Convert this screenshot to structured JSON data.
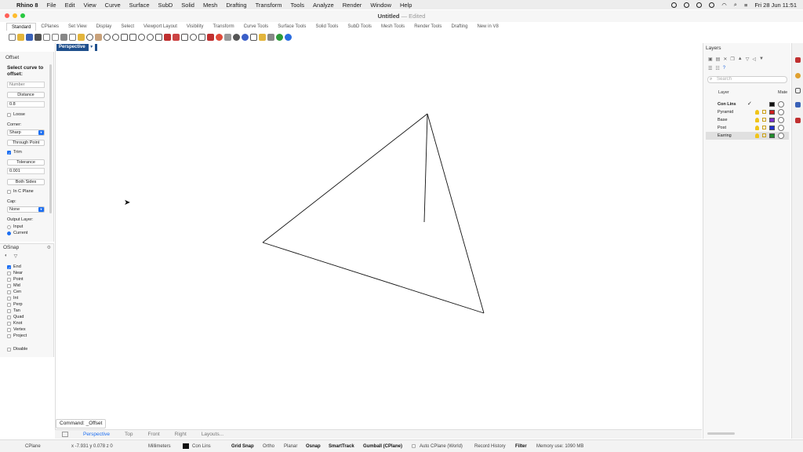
{
  "menubar": {
    "app": "Rhino 8",
    "items": [
      "File",
      "Edit",
      "View",
      "Curve",
      "Surface",
      "SubD",
      "Solid",
      "Mesh",
      "Drafting",
      "Transform",
      "Tools",
      "Analyze",
      "Render",
      "Window",
      "Help"
    ],
    "datetime": "Fri 28 Jun  11:51"
  },
  "window": {
    "title": "Untitled",
    "subtitle": "— Edited"
  },
  "toolbar_tabs": [
    "Standard",
    "CPlanes",
    "Set View",
    "Display",
    "Select",
    "Viewport Layout",
    "Visibility",
    "Transform",
    "Curve Tools",
    "Surface Tools",
    "Solid Tools",
    "SubD Tools",
    "Mesh Tools",
    "Render Tools",
    "Drafting",
    "New in V8"
  ],
  "left_panel": {
    "title": "Offset",
    "prompt": "Select curve to offset:",
    "number_placeholder": "Number",
    "distance_btn": "Distance",
    "distance_value": "0.8",
    "loose": "Loose",
    "corner_label": "Corner:",
    "corner_value": "Sharp",
    "through_point": "Through Point",
    "trim": "Trim",
    "tolerance_btn": "Tolerance",
    "tolerance_value": "0.001",
    "both_sides": "Both Sides",
    "in_cplane": "In C Plane",
    "cap_label": "Cap:",
    "cap_value": "None",
    "output_layer_label": "Output Layer:",
    "output_input": "Input",
    "output_current": "Current"
  },
  "osnap": {
    "title": "OSnap",
    "items": [
      {
        "label": "End",
        "checked": true
      },
      {
        "label": "Near",
        "checked": false
      },
      {
        "label": "Point",
        "checked": false
      },
      {
        "label": "Mid",
        "checked": false
      },
      {
        "label": "Cen",
        "checked": false
      },
      {
        "label": "Int",
        "checked": false
      },
      {
        "label": "Perp",
        "checked": false
      },
      {
        "label": "Tan",
        "checked": false
      },
      {
        "label": "Quad",
        "checked": false
      },
      {
        "label": "Knot",
        "checked": false
      },
      {
        "label": "Vertex",
        "checked": false
      },
      {
        "label": "Project",
        "checked": false
      }
    ],
    "disable": "Disable"
  },
  "viewport": {
    "name": "Perspective",
    "command": "Command: _Offset",
    "tabs": [
      "Perspective",
      "Top",
      "Front",
      "Right",
      "Layouts..."
    ]
  },
  "layers": {
    "title": "Layers",
    "search_placeholder": "Search",
    "col_layer": "Layer",
    "col_material": "Mate",
    "rows": [
      {
        "name": "Con Lins",
        "color": "#111111",
        "current": true
      },
      {
        "name": "Pyramid",
        "color": "#cc1f1f",
        "current": false
      },
      {
        "name": "Base",
        "color": "#7b2fd0",
        "current": false
      },
      {
        "name": "Post",
        "color": "#1f2fd0",
        "current": false
      },
      {
        "name": "Earring",
        "color": "#1e8c2a",
        "current": false
      }
    ]
  },
  "status": {
    "cplane": "CPlane",
    "coords": "x -7.931  y 0.078  z 0",
    "units": "Millimeters",
    "layer": "Con Lins",
    "grid_snap": "Grid Snap",
    "ortho": "Ortho",
    "planar": "Planar",
    "osnap": "Osnap",
    "smarttrack": "SmartTrack",
    "gumball": "Gumball (CPlane)",
    "auto_cplane": "Auto CPlane (World)",
    "record_history": "Record History",
    "filter": "Filter",
    "memory": "Memory use: 1090 MB"
  }
}
